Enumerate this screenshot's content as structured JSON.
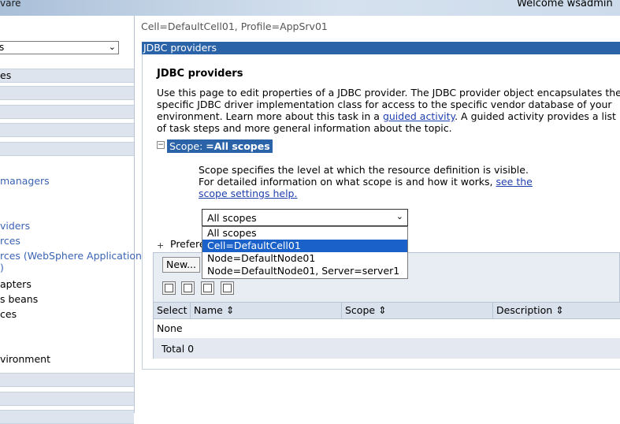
{
  "header": {
    "brand": "vare",
    "welcome": "Welcome wsadmin"
  },
  "leftnav": {
    "select_value": "s",
    "items": [
      {
        "label": "es",
        "style": "bar"
      },
      {
        "label": "",
        "style": "bar"
      },
      {
        "label": "",
        "style": "bar"
      },
      {
        "label": "",
        "style": "bar"
      },
      {
        "label": "",
        "style": "bar"
      },
      {
        "label": "",
        "style": "bar"
      },
      {
        "label": "managers",
        "style": "link"
      },
      {
        "label": "viders",
        "style": "link"
      },
      {
        "label": "rces",
        "style": "link"
      },
      {
        "label": "rces (WebSphere Application",
        "style": "link"
      },
      {
        "label": ")",
        "style": "link"
      },
      {
        "label": "apters",
        "style": "text"
      },
      {
        "label": "s beans",
        "style": "text"
      },
      {
        "label": "ces",
        "style": "text"
      },
      {
        "label": "vironment",
        "style": "text"
      }
    ]
  },
  "breadcrumb": "Cell=DefaultCell01, Profile=AppSrv01",
  "portlet_title": "JDBC providers",
  "page_heading": "JDBC providers",
  "intro": {
    "text_before_link": "Use this page to edit properties of a JDBC provider. The JDBC provider object encapsulates the specific JDBC driver implementation class for access to the specific vendor database of your environment. Learn more about this task in a ",
    "link": "guided activity",
    "text_after_link": ". A guided activity provides a list of task steps and more general information about the topic."
  },
  "scope": {
    "toggle": "−",
    "label": "Scope:",
    "value": "=All scopes",
    "desc_line1": "Scope specifies the level at which the resource definition is visible.",
    "desc_line2": "For detailed information on what scope is and how it works, ",
    "desc_link": "see the scope settings help.",
    "select_value": "All scopes",
    "options": [
      "All scopes",
      "Cell=DefaultCell01",
      "Node=DefaultNode01",
      "Node=DefaultNode01, Server=server1"
    ],
    "highlighted_option": "Cell=DefaultCell01"
  },
  "preferences": {
    "toggle": "+",
    "label": "Prefere"
  },
  "table": {
    "new_button": "New...",
    "toolbar_icons": [
      "select-all-icon",
      "deselect-all-icon",
      "show-filter-icon",
      "clear-filter-icon"
    ],
    "columns": [
      "Select",
      "Name",
      "Scope",
      "Description"
    ],
    "sort_glyph": "⇕",
    "empty_text": "None",
    "total_label": "Total 0"
  }
}
